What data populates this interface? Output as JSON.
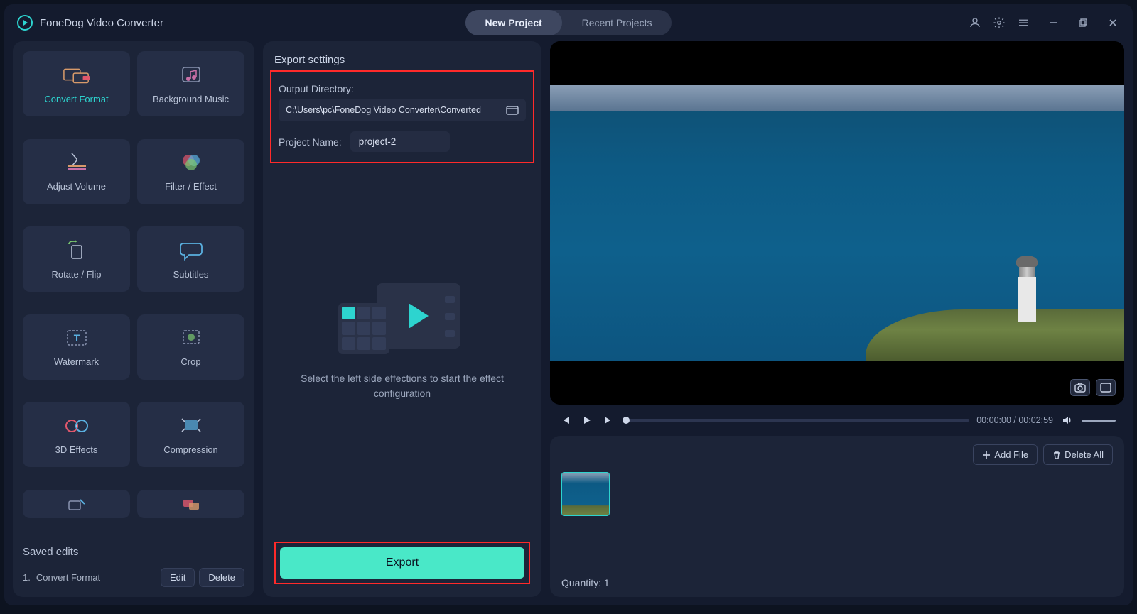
{
  "app": {
    "title": "FoneDog Video Converter"
  },
  "tabs": {
    "new_project": "New Project",
    "recent_projects": "Recent Projects"
  },
  "effects": [
    {
      "name": "Convert Format",
      "active": true
    },
    {
      "name": "Background Music"
    },
    {
      "name": "Adjust Volume"
    },
    {
      "name": "Filter / Effect"
    },
    {
      "name": "Rotate / Flip"
    },
    {
      "name": "Subtitles"
    },
    {
      "name": "Watermark"
    },
    {
      "name": "Crop"
    },
    {
      "name": "3D Effects"
    },
    {
      "name": "Compression"
    }
  ],
  "saved_edits": {
    "title": "Saved edits",
    "items": [
      {
        "index": "1.",
        "name": "Convert Format"
      }
    ],
    "edit_label": "Edit",
    "delete_label": "Delete"
  },
  "export_settings": {
    "title": "Export settings",
    "output_directory_label": "Output Directory:",
    "output_directory_value": "C:\\Users\\pc\\FoneDog Video Converter\\Converted",
    "project_name_label": "Project Name:",
    "project_name_value": "project-2",
    "placeholder_text": "Select the left side effections to start the effect configuration",
    "export_button": "Export"
  },
  "player": {
    "current_time": "00:00:00",
    "total_time": "00:02:59",
    "sep": " / "
  },
  "bottom": {
    "add_file": "Add File",
    "delete_all": "Delete All",
    "quantity_label": "Quantity: ",
    "quantity_value": "1"
  }
}
